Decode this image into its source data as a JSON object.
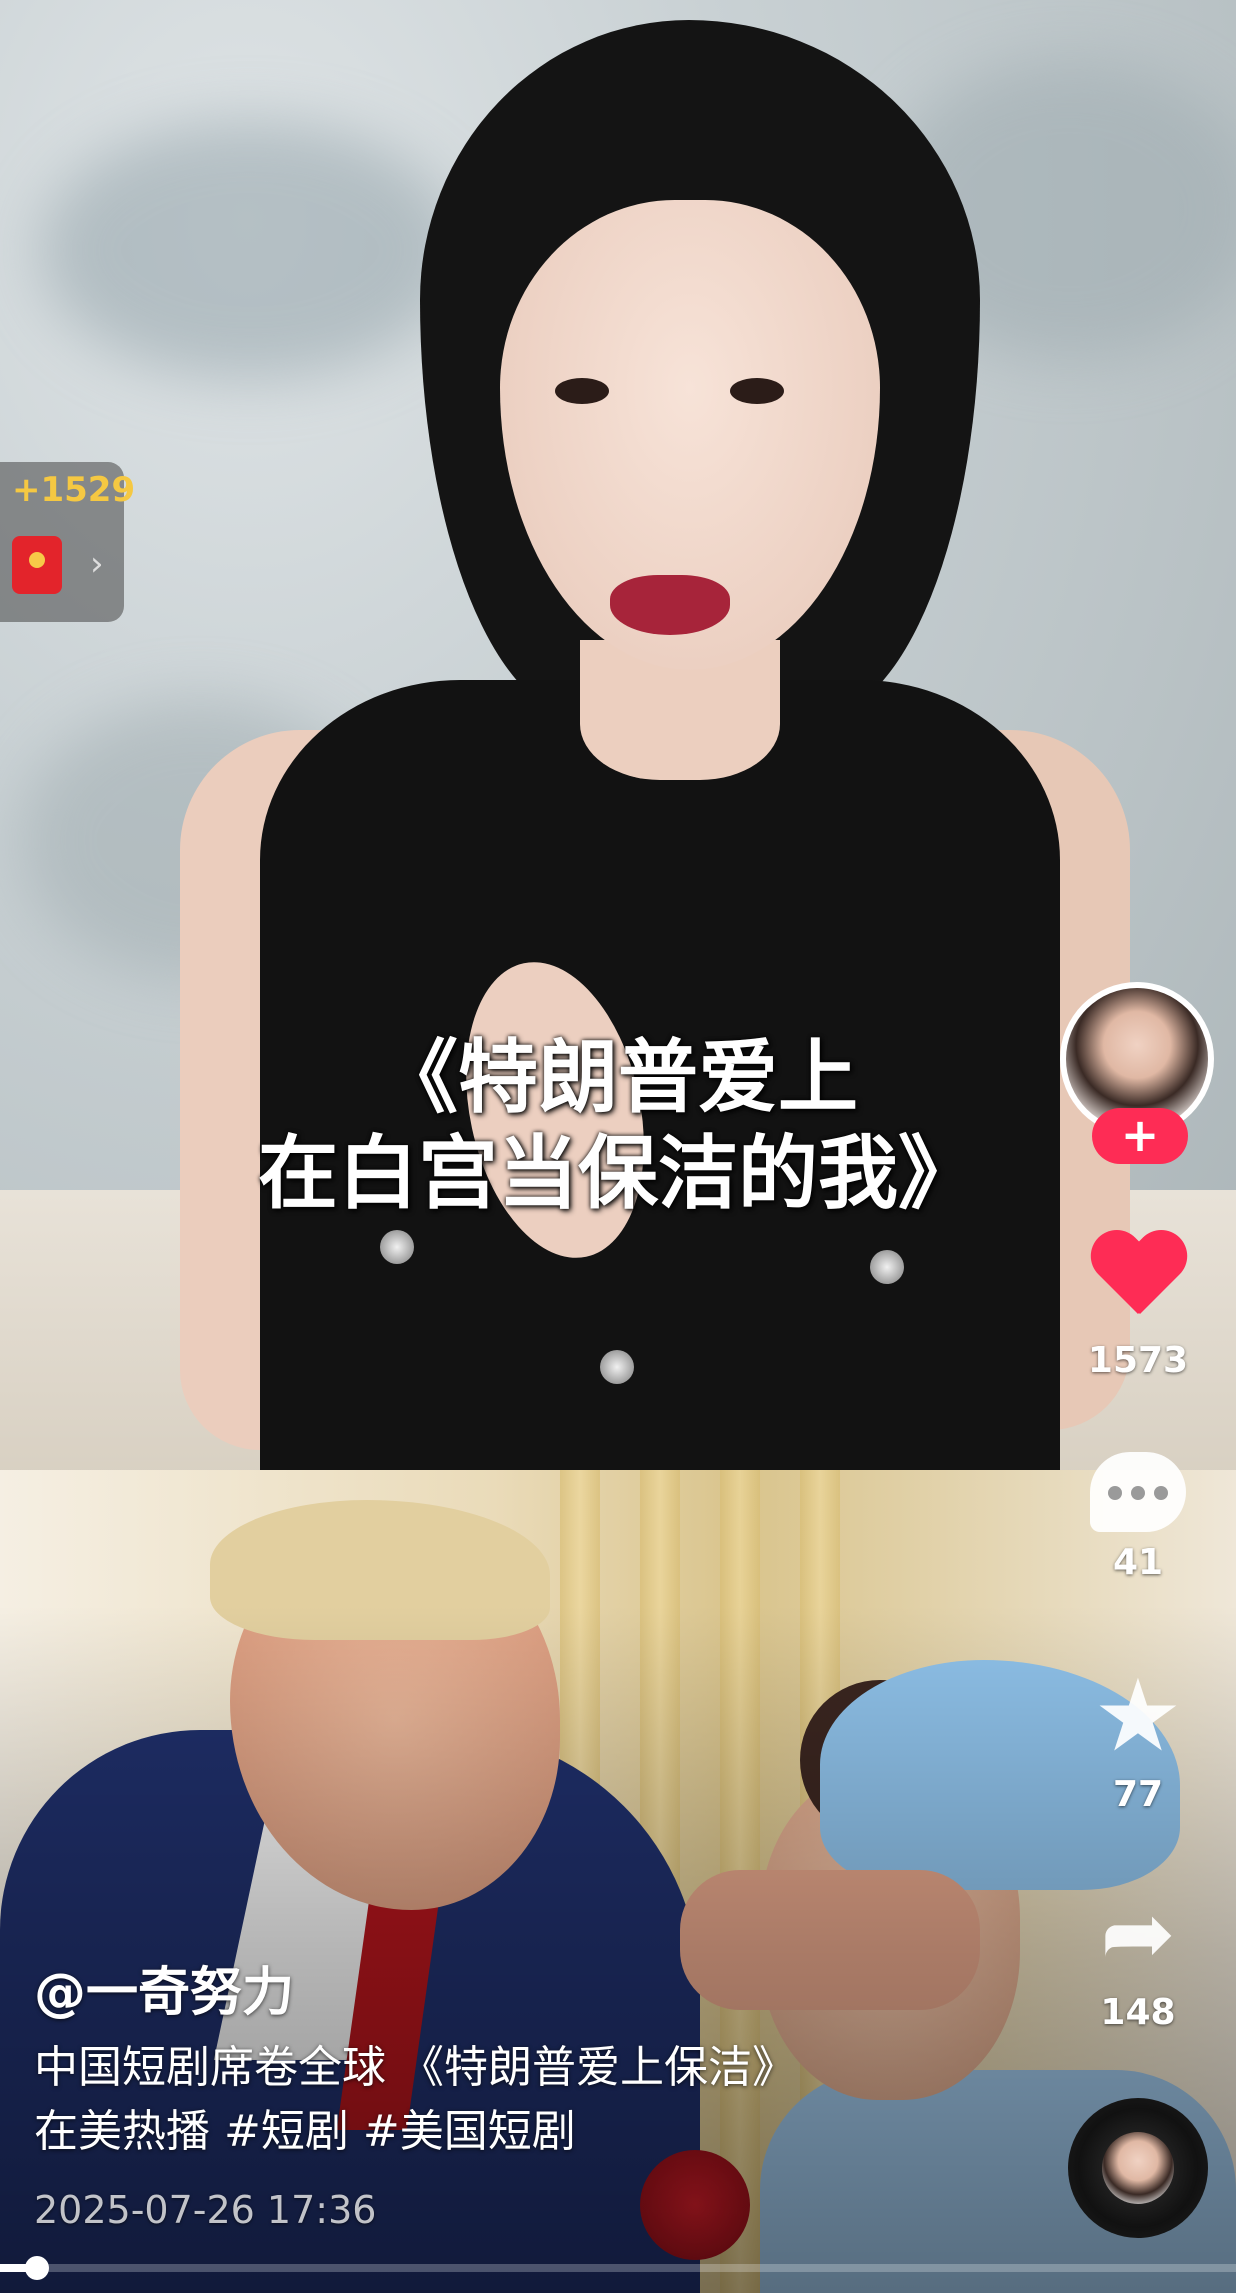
{
  "video": {
    "subtitle_lines": [
      "《特朗普爱上",
      "在白宫当保洁的我》"
    ]
  },
  "reward": {
    "amount": "+1529",
    "arrow": "›"
  },
  "sidebar": {
    "follow_label": "+",
    "like_count": "1573",
    "comment_count": "41",
    "favorite_count": "77",
    "share_count": "148",
    "favorite_icon": "★",
    "share_icon": "➦"
  },
  "post": {
    "author": "@一奇努力",
    "description_lines": [
      "中国短剧席卷全球 《特朗普爱上保洁》",
      "在美热播 #短剧 #美国短剧"
    ],
    "timestamp": "2025-07-26 17:36"
  },
  "playback": {
    "progress": 0.03
  },
  "colors": {
    "accent": "#fe2c55",
    "reward_text": "#f5c842"
  },
  "icons": [
    "red-packet-icon",
    "heart-icon",
    "comment-icon",
    "star-icon",
    "share-icon",
    "music-disc-icon"
  ]
}
